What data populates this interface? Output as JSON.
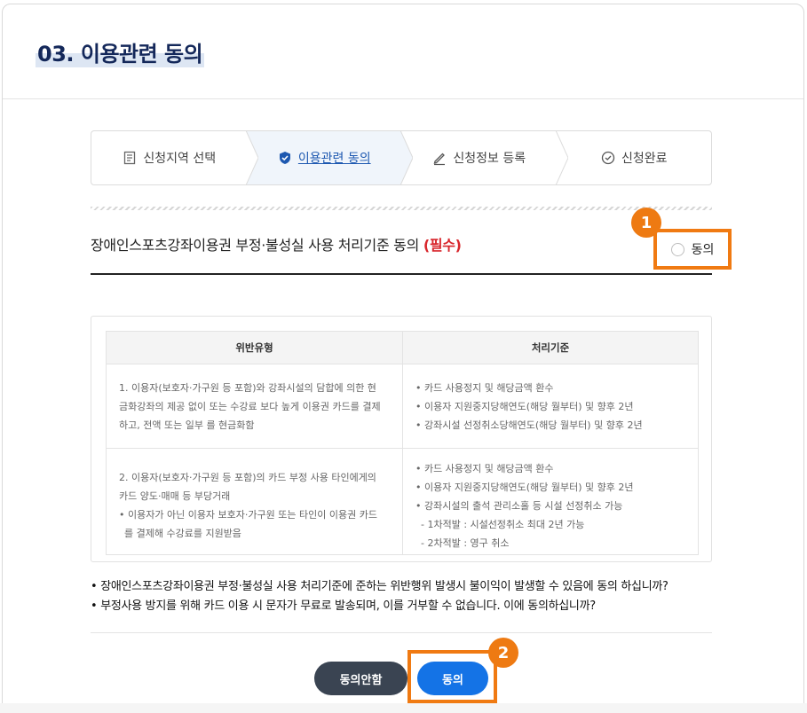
{
  "page_title": "03. 이용관련 동의",
  "steps": [
    {
      "label": "신청지역 선택",
      "icon": "document-icon",
      "active": false
    },
    {
      "label": "이용관련 동의",
      "icon": "shield-icon",
      "active": true
    },
    {
      "label": "신청정보 등록",
      "icon": "pencil-icon",
      "active": false
    },
    {
      "label": "신청완료",
      "icon": "check-circle-icon",
      "active": false
    }
  ],
  "section": {
    "title": "장애인스포츠강좌이용권 부정·불성실 사용 처리기준 동의",
    "required_label": "(필수)",
    "agree_label": "동의"
  },
  "table": {
    "headers": [
      "위반유형",
      "처리기준"
    ],
    "rows": [
      {
        "violation": [
          "1. 이용자(보호자·가구원 등 포함)와 강좌시설의 담합에 의한 현",
          "금화강좌의 제공 없이 또는 수강료 보다 높게 이용권 카드를 결제",
          "하고, 전액 또는 일부 를 현금화함"
        ],
        "measures": [
          "• 카드 사용정지 및 해당금액 환수",
          "• 이용자 지원중지당해연도(해당 월부터) 및 향후 2년",
          "• 강좌시설 선정취소당해연도(해당 월부터) 및 향후 2년"
        ]
      },
      {
        "violation": [
          "2. 이용자(보호자·가구원 등 포함)의 카드 부정 사용 타인에게의",
          "카드 양도·매매 등 부당거래",
          "• 이용자가 아닌 이용자 보호자·가구원 또는 타인이 이용권 카드",
          "를 결제해 수강료를 지원받음"
        ],
        "measures": [
          "• 카드 사용정지 및 해당금액 환수",
          "• 이용자 지원중지당해연도(해당 월부터) 및 향후 2년",
          "• 강좌시설의 출석 관리소홀 등 시설 선정취소 가능",
          "- 1차적발 : 시설선정취소 최대 2년 가능",
          "- 2차적발 : 영구 취소"
        ]
      }
    ]
  },
  "notes": [
    "• 장애인스포츠강좌이용권 부정·불성실 사용 처리기준에 준하는 위반행위 발생시 불이익이 발생할 수 있음에 동의 하십니까?",
    "• 부정사용 방지를 위해 카드 이용 시 문자가 무료로 발송되며, 이를 거부할 수 없습니다. 이에 동의하십니까?"
  ],
  "buttons": {
    "disagree": "동의안함",
    "agree": "동의"
  },
  "badges": [
    "1",
    "2"
  ],
  "colors": {
    "accent": "#1473e6",
    "highlight": "#f07a12",
    "required": "#d8262c",
    "title": "#14285a"
  }
}
